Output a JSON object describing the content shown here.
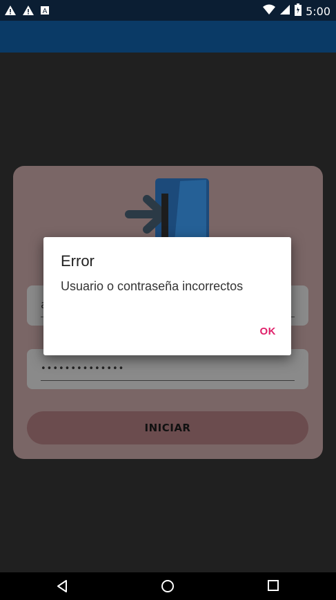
{
  "status_bar": {
    "time": "5:00",
    "left_icons": [
      "warning-icon",
      "warning-icon",
      "notification-a-icon"
    ],
    "right_icons": [
      "wifi-icon",
      "signal-icon",
      "battery-icon"
    ]
  },
  "login": {
    "username_value": "a",
    "password_value": "••••••••••••••",
    "submit_label": "INICIAR"
  },
  "dialog": {
    "title": "Error",
    "message": "Usuario o contraseña incorrectos",
    "ok_label": "OK"
  },
  "colors": {
    "app_bar": "#0a3a66",
    "accent": "#e0206a"
  }
}
